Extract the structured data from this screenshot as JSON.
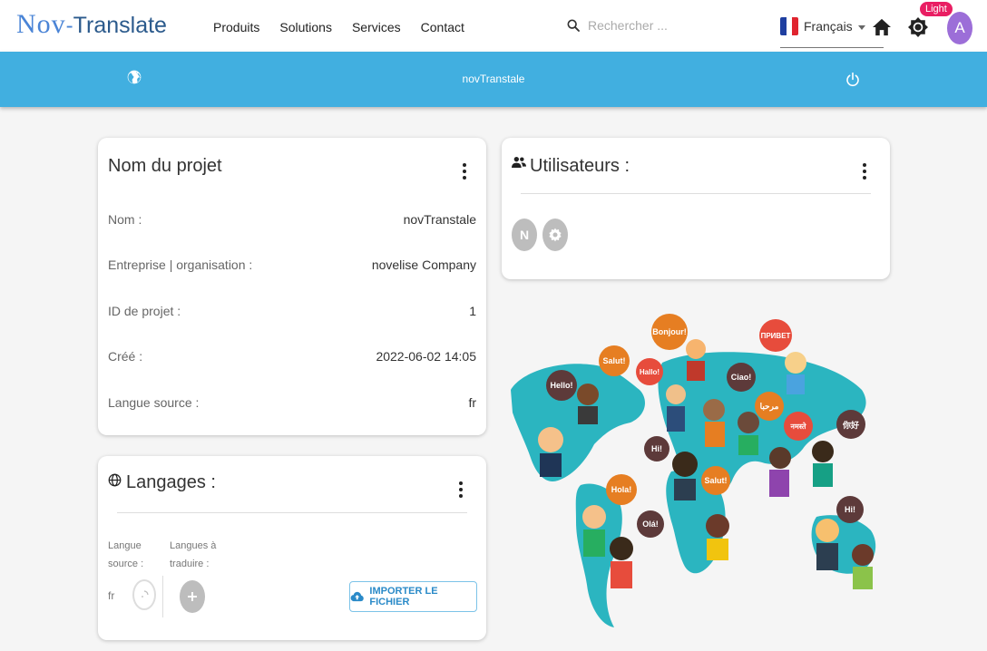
{
  "brand": {
    "part1": "Nov",
    "dash": "-",
    "part2": "Translate"
  },
  "nav": [
    "Produits",
    "Solutions",
    "Services",
    "Contact"
  ],
  "search": {
    "placeholder": "Rechercher ..."
  },
  "language": {
    "selected": "Français"
  },
  "theme": {
    "badge": "Light"
  },
  "user": {
    "initial": "A"
  },
  "projectBar": {
    "title": "novTranstale"
  },
  "projectCard": {
    "title": "Nom du projet",
    "rows": [
      {
        "key": "Nom :",
        "value": "novTranstale"
      },
      {
        "key": "Entreprise | organisation :",
        "value": "novelise Company"
      },
      {
        "key": "ID de projet :",
        "value": "1"
      },
      {
        "key": "Créé :",
        "value": "2022-06-02 14:05"
      },
      {
        "key": "Langue source :",
        "value": "fr"
      }
    ]
  },
  "usersCard": {
    "title": "Utilisateurs :",
    "users": [
      {
        "initial": "N"
      }
    ]
  },
  "languagesCard": {
    "title": "Langages :",
    "sourceLabelLine1": "Langue",
    "sourceLabelLine2": "source :",
    "targetLabelLine1": "Langues à",
    "targetLabelLine2": "traduire :",
    "sourceValue": "fr",
    "importButton": "IMPORTER LE FICHIER"
  },
  "illustration": {
    "bubbles": [
      "Bonjour!",
      "ПРИВЕТ",
      "Salut!",
      "Hallo!",
      "Hello!",
      "Ciao!",
      "مرحبا",
      "नमस्ते",
      "你好",
      "Hi!",
      "Salut!",
      "Hola!",
      "Olá!",
      "Hi!"
    ]
  },
  "colors": {
    "primary": "#41afe0",
    "avatar": "#9c6ed8",
    "badge": "#e91e63",
    "map": "#2bb5c0"
  }
}
